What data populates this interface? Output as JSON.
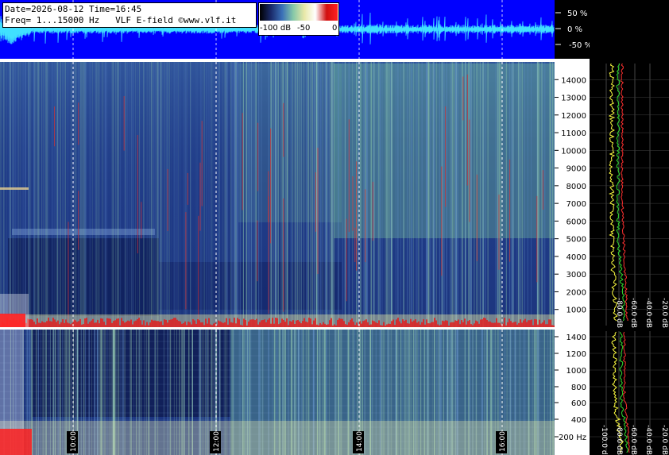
{
  "header": {
    "date_line": "Date=2026-08-12 Time=16:45",
    "freq_line": "Freq= 1...15000 Hz   VLF E-field ©www.vlf.it"
  },
  "colorbar": {
    "labels": [
      "-100 dB",
      "-50",
      "0"
    ],
    "stops": [
      "#000000",
      "#1a2a6a",
      "#3a70b8",
      "#86c8a8",
      "#e8e8a8",
      "#ffffff",
      "#d01010",
      "#ff2020"
    ]
  },
  "colors": {
    "waveform_bg": "#0000ff",
    "waveform": "#40e0ff",
    "spectrum_yellow": "#ffff40",
    "spectrum_green": "#30e030",
    "spectrum_red": "#ff3030",
    "spectrogram_base": "#1f3a86",
    "spectrogram_green": "#7fd2a0"
  },
  "chart_data": [
    {
      "type": "line",
      "ylabel": "",
      "y_ticks": [
        "50 %",
        "0 %",
        "-50 %"
      ],
      "ylim": [
        -100,
        100
      ]
    },
    {
      "type": "heatmap",
      "y_ticks": [
        1000,
        2000,
        3000,
        4000,
        5000,
        6000,
        7000,
        8000,
        9000,
        10000,
        11000,
        12000,
        13000,
        14000
      ],
      "ylim": [
        0,
        15000
      ],
      "x_ticks": [
        "10:00",
        "12:00",
        "14:00",
        "16:00"
      ]
    },
    {
      "type": "heatmap",
      "y_ticks": [
        "200 Hz",
        "400",
        "600",
        "800",
        "1000",
        "1200",
        "1400"
      ],
      "ylim": [
        0,
        1500
      ],
      "x_ticks": [
        "10:00",
        "12:00",
        "14:00",
        "16:00"
      ]
    },
    {
      "type": "line",
      "x_ticks": [
        "-20.0 dB",
        "-40.0 dB",
        "-60.0 dB",
        "-80.0 dB"
      ],
      "series_colors": [
        "#ffff40",
        "#30e030",
        "#ff3030"
      ]
    },
    {
      "type": "line",
      "x_ticks": [
        "-20.0 dB",
        "-40.0 dB",
        "-60.0 dB",
        "-80.0 dB",
        "-100.0 dB"
      ],
      "series_colors": [
        "#ffff40",
        "#30e030",
        "#ff3030"
      ]
    }
  ]
}
